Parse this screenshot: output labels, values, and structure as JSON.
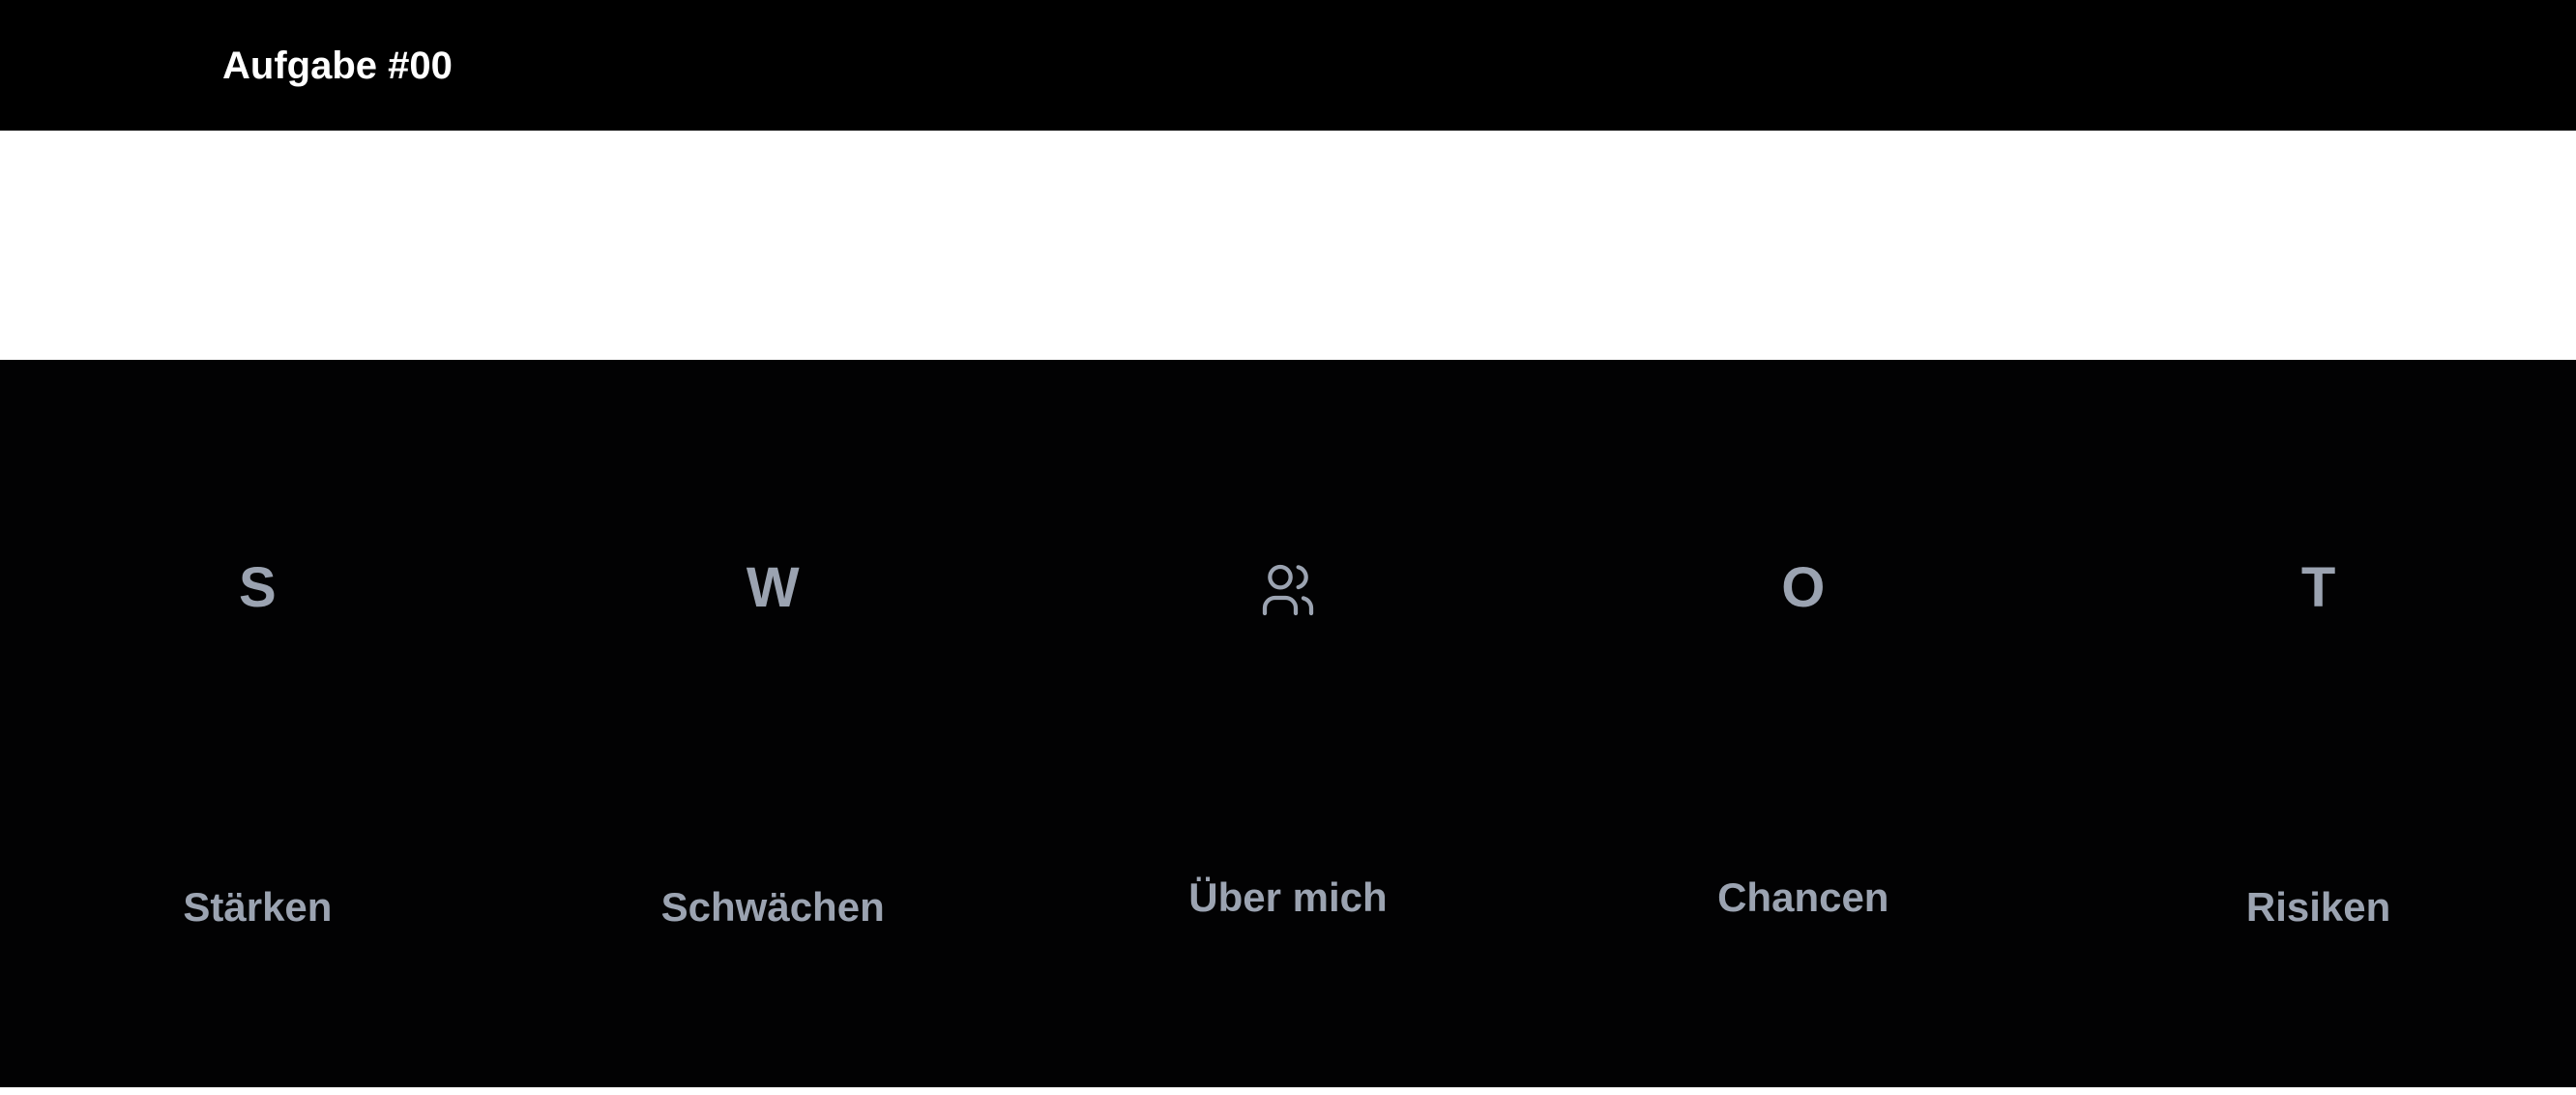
{
  "header": {
    "title": "Aufgabe #00"
  },
  "swot": {
    "columns": [
      {
        "letter": "S",
        "label": "Stärken"
      },
      {
        "letter": "W",
        "label": "Schwächen"
      },
      {
        "icon": "users-icon",
        "label": "Über mich"
      },
      {
        "letter": "O",
        "label": "Chancen"
      },
      {
        "letter": "T",
        "label": "Risiken"
      }
    ]
  },
  "colors": {
    "background": "#020203",
    "band": "#ffffff",
    "title": "#ffffff",
    "text_muted": "#9ba3b1"
  }
}
